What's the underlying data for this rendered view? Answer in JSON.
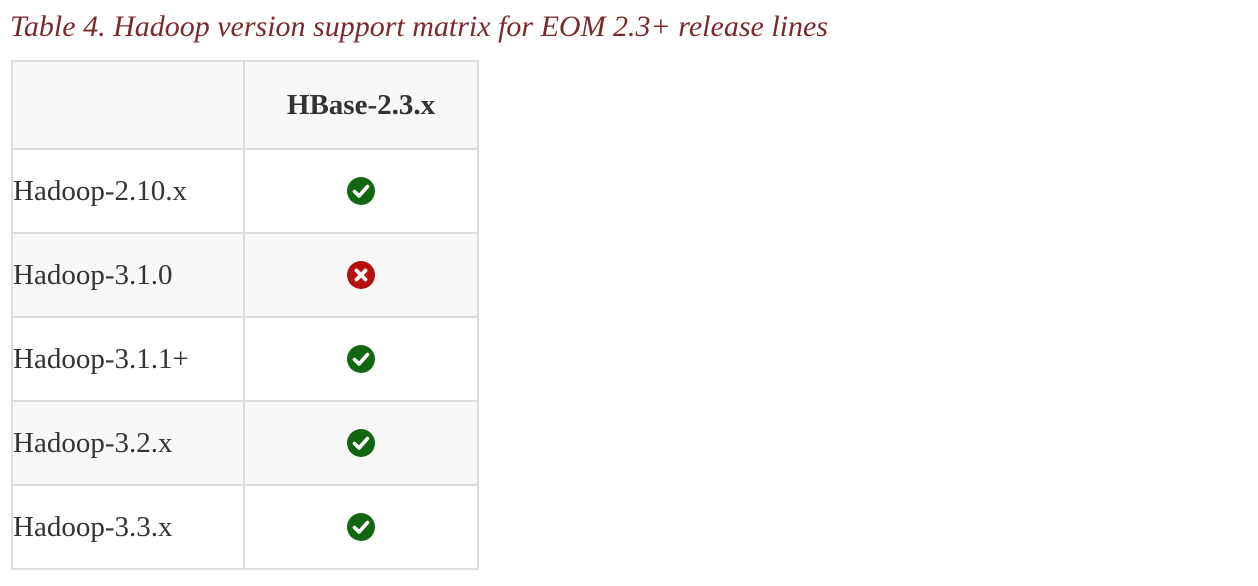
{
  "caption": "Table 4. Hadoop version support matrix for EOM 2.3+ release lines",
  "table": {
    "corner": "",
    "column_header": "HBase-2.3.x",
    "rows": [
      {
        "label": "Hadoop-2.10.x",
        "status": "supported",
        "icon": "check-circle-icon"
      },
      {
        "label": "Hadoop-3.1.0",
        "status": "not-supported",
        "icon": "x-circle-icon"
      },
      {
        "label": "Hadoop-3.1.1+",
        "status": "supported",
        "icon": "check-circle-icon"
      },
      {
        "label": "Hadoop-3.2.x",
        "status": "supported",
        "icon": "check-circle-icon"
      },
      {
        "label": "Hadoop-3.3.x",
        "status": "supported",
        "icon": "check-circle-icon"
      }
    ]
  },
  "colors": {
    "caption": "#7a2a2a",
    "supported": "#116611",
    "not_supported": "#b50f0f",
    "border": "#dddddd",
    "stripe": "#f8f8f8"
  }
}
